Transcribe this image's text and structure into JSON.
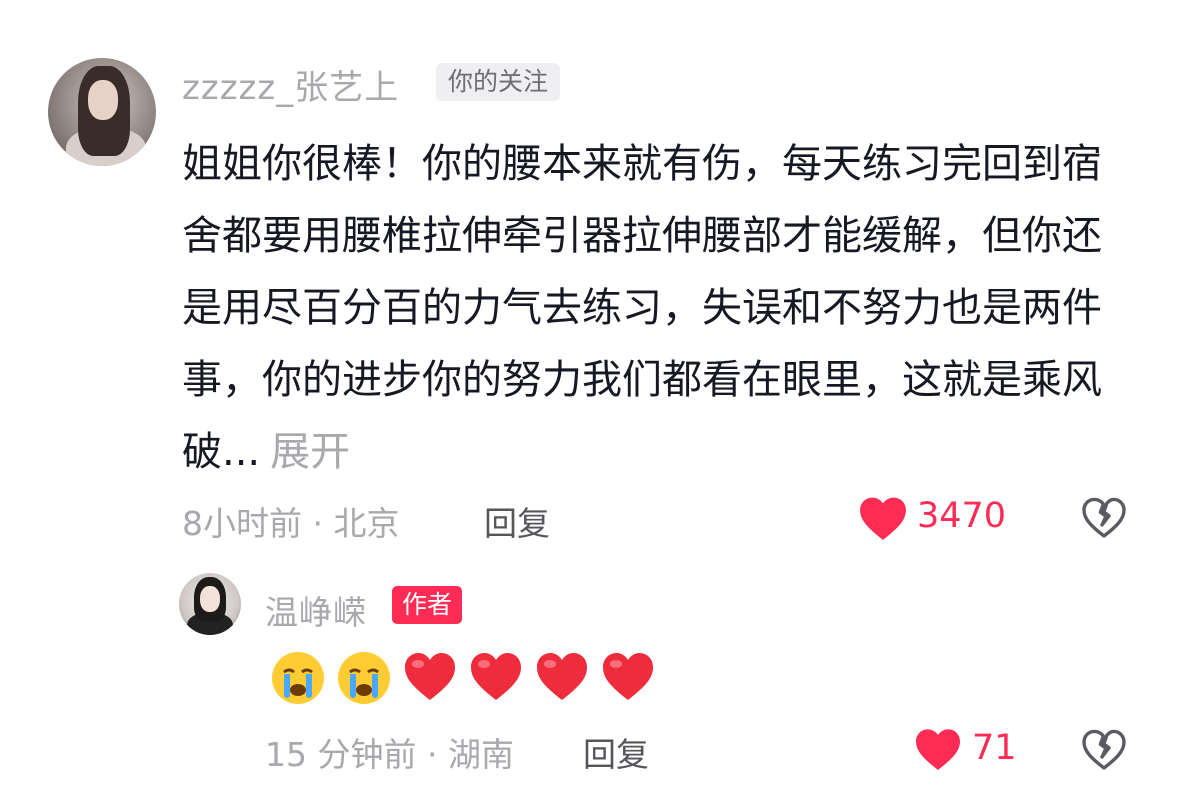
{
  "comments": [
    {
      "username": "zzzzz_张艺上",
      "tag": "你的关注",
      "text": "姐姐你很棒！你的腰本来就有伤，每天练习完回到宿舍都要用腰椎拉伸牵引器拉伸腰部才能缓解，但你还是用尽百分百的力气去练习，失误和不努力也是两件事，你的进步你的努力我们都看在眼里，这就是乘风破...",
      "expand_label": "展开",
      "time_location": "8小时前 · 北京",
      "reply_label": "回复",
      "likes": "3470"
    }
  ],
  "reply": {
    "username": "温峥嵘",
    "tag": "作者",
    "emojis": [
      "crying-face",
      "crying-face",
      "red-heart",
      "red-heart",
      "red-heart",
      "red-heart"
    ],
    "time_location": "15 分钟前 · 湖南",
    "reply_label": "回复",
    "likes": "71"
  },
  "colors": {
    "accent": "#fe2c55",
    "muted": "#a8a8ad",
    "text": "#161823"
  }
}
